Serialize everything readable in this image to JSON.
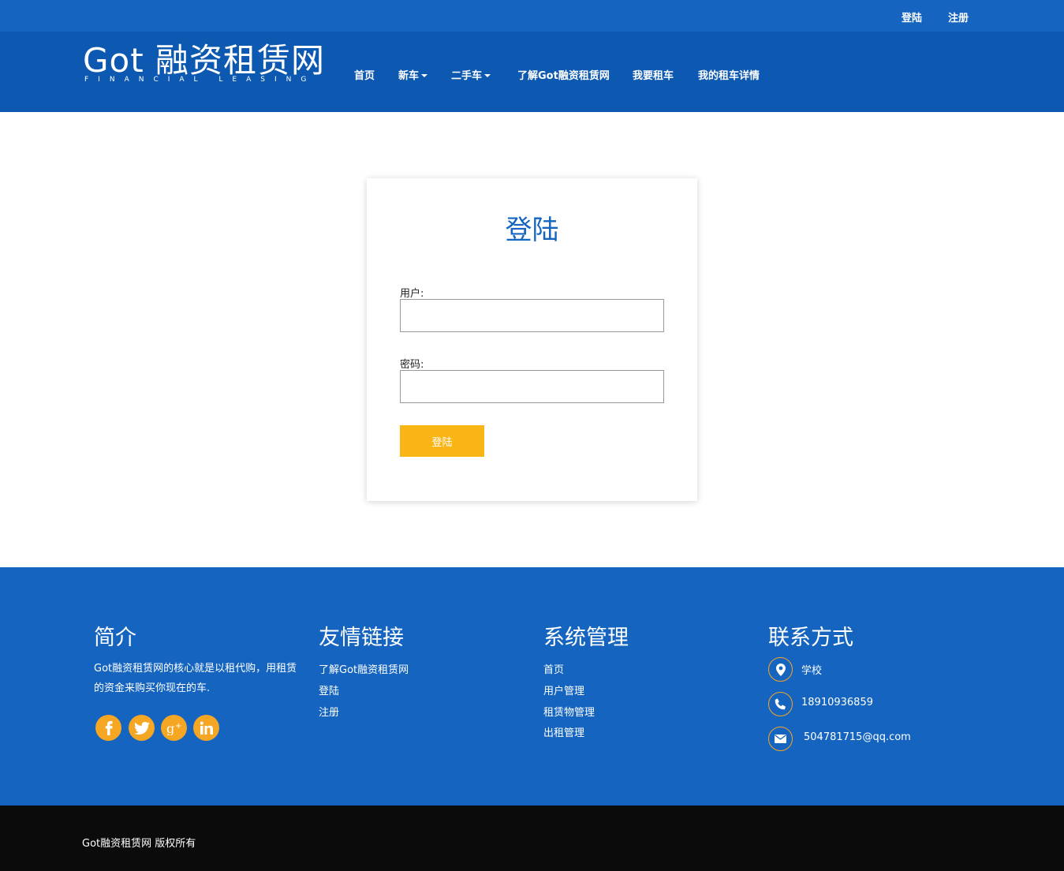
{
  "topbar": {
    "login_label": "登陆",
    "register_label": "注册"
  },
  "brand": {
    "logo_main": "Got 融资租赁网",
    "logo_sub": "FINANCIAL LEASING"
  },
  "nav": {
    "home": "首页",
    "new_car": "新车",
    "used_car": "二手车",
    "about": "了解Got融资租赁网",
    "rent": "我要租车",
    "my_rentals": "我的租车详情"
  },
  "login": {
    "title": "登陆",
    "user_label": "用户:",
    "user_value": "",
    "password_label": "密码:",
    "password_value": "",
    "submit_label": "登陆"
  },
  "footer": {
    "intro": {
      "title": "简介",
      "text": "Got融资租赁网的核心就是以租代购，用租赁的资金来购买你现在的车."
    },
    "social_icons": [
      "facebook-icon",
      "twitter-icon",
      "google-plus-icon",
      "linkedin-icon"
    ],
    "links": {
      "title": "友情链接",
      "items": [
        "了解Got融资租赁网",
        "登陆",
        "注册"
      ]
    },
    "system": {
      "title": "系统管理",
      "items": [
        "首页",
        "用户管理",
        "租赁物管理",
        "出租管理"
      ]
    },
    "contact": {
      "title": "联系方式",
      "address": "学校",
      "phone": "18910936859",
      "email": "504781715@qq.com"
    }
  },
  "copyright": "Got融资租赁网 版权所有",
  "colors": {
    "primary_blue": "#1565c0",
    "nav_blue": "#0d59b1",
    "accent_orange": "#f5a623",
    "button_yellow": "#f9b515",
    "bottom_black": "#0b0b0b"
  }
}
